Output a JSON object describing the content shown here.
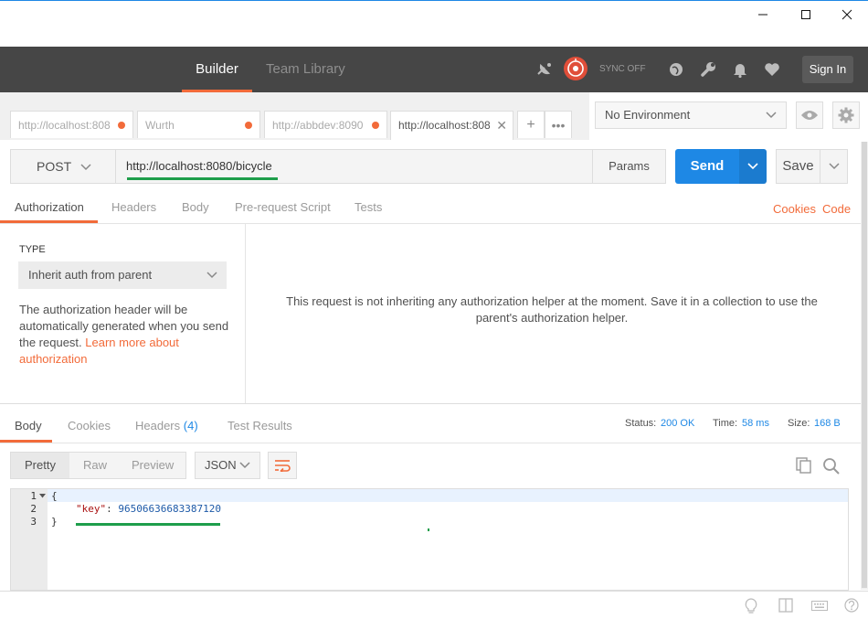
{
  "header": {
    "nav": [
      "Builder",
      "Team Library"
    ],
    "sync_label": "SYNC OFF",
    "signin_label": "Sign In"
  },
  "tabs": [
    {
      "label": "http://localhost:808"
    },
    {
      "label": "Wurth"
    },
    {
      "label": "http://abbdev:8090"
    },
    {
      "label": "http://localhost:808"
    }
  ],
  "environment": {
    "selected": "No Environment"
  },
  "request": {
    "method": "POST",
    "url": "http://localhost:8080/bicycle",
    "params_label": "Params",
    "send_label": "Send",
    "save_label": "Save",
    "tabs": [
      "Authorization",
      "Headers",
      "Body",
      "Pre-request Script",
      "Tests"
    ],
    "cookies_label": "Cookies",
    "code_label": "Code"
  },
  "auth": {
    "type_label": "TYPE",
    "type_value": "Inherit auth from parent",
    "description": "The authorization header will be automatically generated when you send the request.",
    "learn_more": "Learn more about authorization",
    "message": "This request is not inheriting any authorization helper at the moment. Save it in a collection to use the parent's authorization helper."
  },
  "response": {
    "tabs": {
      "body": "Body",
      "cookies": "Cookies",
      "headers": "Headers",
      "headers_count": "(4)",
      "tests": "Test Results"
    },
    "status_label": "Status:",
    "status_value": "200 OK",
    "time_label": "Time:",
    "time_value": "58 ms",
    "size_label": "Size:",
    "size_value": "168 B",
    "view_modes": [
      "Pretty",
      "Raw",
      "Preview"
    ],
    "format": "JSON",
    "line_numbers": [
      "1",
      "2",
      "3"
    ],
    "code": {
      "open": "{",
      "key": "\"key\"",
      "colon": ": ",
      "value": "96506636683387120",
      "close": "}"
    }
  },
  "colors": {
    "accent": "#f26b3a",
    "send": "#1e88e5",
    "header_bg": "#464646"
  }
}
